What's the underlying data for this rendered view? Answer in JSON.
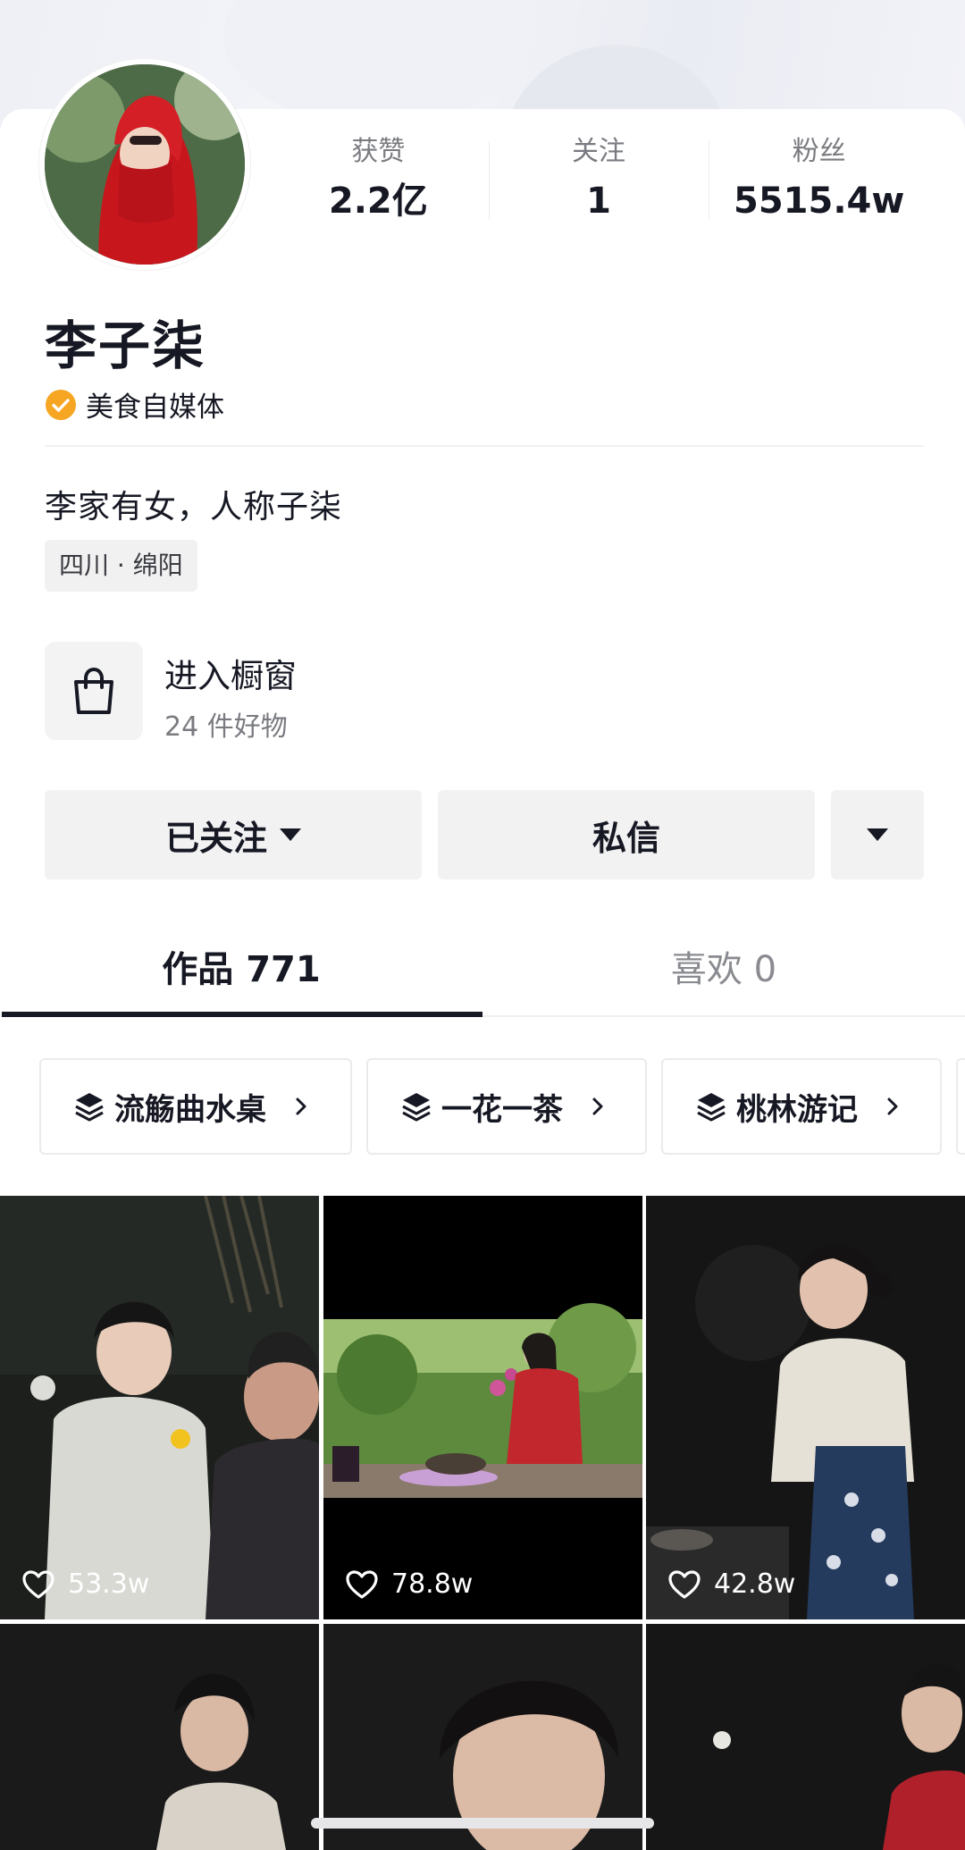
{
  "profile": {
    "name": "李子柒",
    "verification": "美食自媒体",
    "bio": "李家有女，人称子柒",
    "location": "四川 · 绵阳"
  },
  "stats": [
    {
      "label": "获赞",
      "value": "2.2亿"
    },
    {
      "label": "关注",
      "value": "1"
    },
    {
      "label": "粉丝",
      "value": "5515.4w"
    }
  ],
  "shop": {
    "title": "进入橱窗",
    "subtitle": "24 件好物"
  },
  "actions": {
    "follow_label": "已关注",
    "message_label": "私信"
  },
  "tabs": [
    {
      "label": "作品 771",
      "active": true
    },
    {
      "label": "喜欢 0",
      "active": false
    }
  ],
  "collections": [
    {
      "label": "流觞曲水桌"
    },
    {
      "label": "一花一茶"
    },
    {
      "label": "桃林游记"
    }
  ],
  "videos": [
    {
      "likes": "53.3w"
    },
    {
      "likes": "78.8w"
    },
    {
      "likes": "42.8w"
    },
    {
      "likes": ""
    },
    {
      "likes": ""
    },
    {
      "likes": ""
    }
  ],
  "icons": {
    "verify": "verified-badge-icon",
    "shop": "shopping-bag-icon",
    "collection": "layers-icon",
    "like": "heart-icon",
    "dropdown": "triangle-down-icon"
  },
  "colors": {
    "verify_badge": "#f6a623",
    "text_primary": "#161823",
    "text_secondary": "#7a7b80",
    "button_bg": "#f2f2f3"
  }
}
